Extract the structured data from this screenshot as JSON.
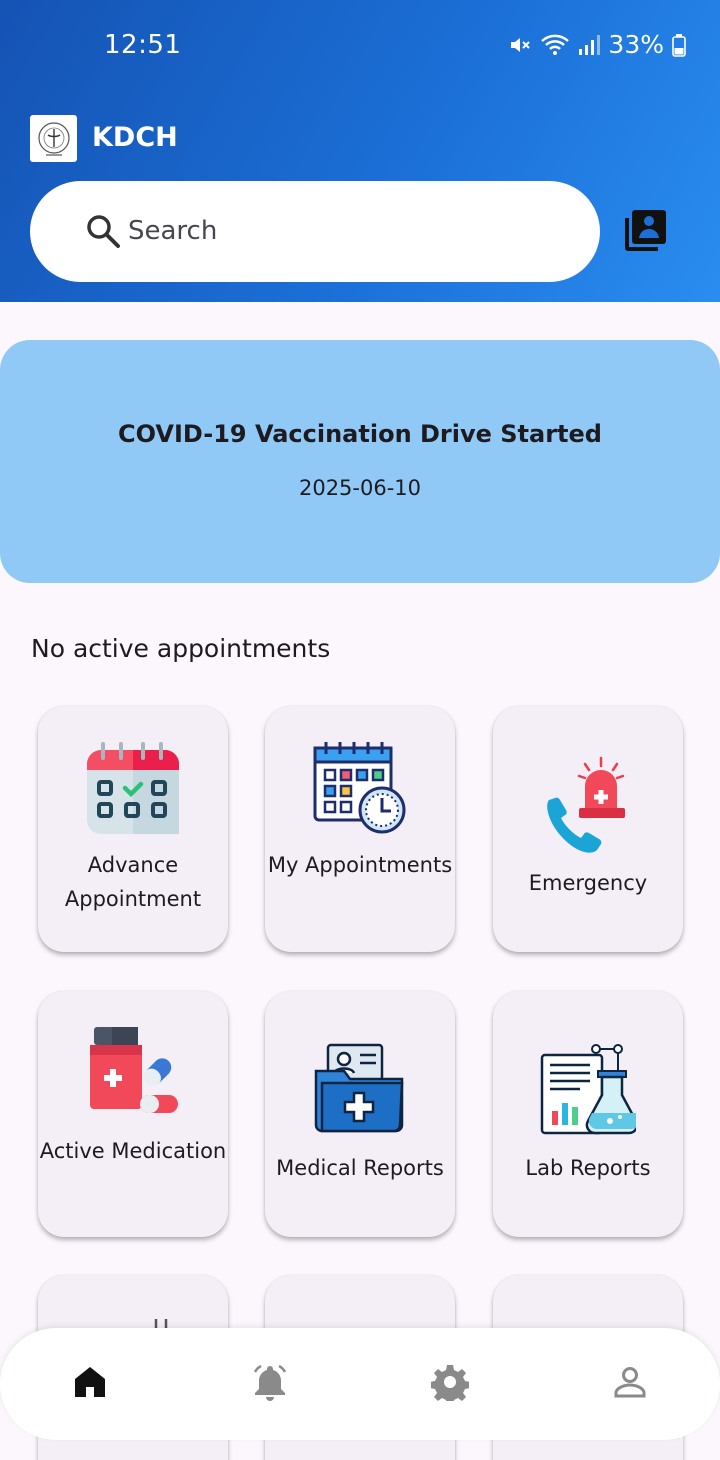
{
  "status_bar": {
    "time": "12:51",
    "battery": "33%"
  },
  "header": {
    "title": "KDCH"
  },
  "search": {
    "placeholder": "Search"
  },
  "banner": {
    "title": "COVID-19 Vaccination Drive Started",
    "date": "2025-06-10"
  },
  "appointments": {
    "empty_text": "No active appointments"
  },
  "tiles": [
    {
      "label": "Advance Appointment",
      "icon": "calendar-check-icon"
    },
    {
      "label": "My Appointments",
      "icon": "calendar-clock-icon"
    },
    {
      "label": "Emergency",
      "icon": "emergency-alarm-phone-icon"
    },
    {
      "label": "Active Medication",
      "icon": "medication-bottle-icon"
    },
    {
      "label": "Medical Reports",
      "icon": "medical-folder-icon"
    },
    {
      "label": "Lab Reports",
      "icon": "lab-flask-report-icon"
    }
  ],
  "bottom_nav": [
    {
      "name": "home",
      "icon": "home-icon",
      "active": true
    },
    {
      "name": "notifications",
      "icon": "bell-icon"
    },
    {
      "name": "settings",
      "icon": "gear-icon"
    },
    {
      "name": "profile",
      "icon": "person-icon"
    }
  ],
  "colors": {
    "header_start": "#1553b4",
    "header_end": "#2a8df0",
    "banner": "#90c8f6",
    "background": "#fcf6fd",
    "tile": "#f4eef6"
  }
}
